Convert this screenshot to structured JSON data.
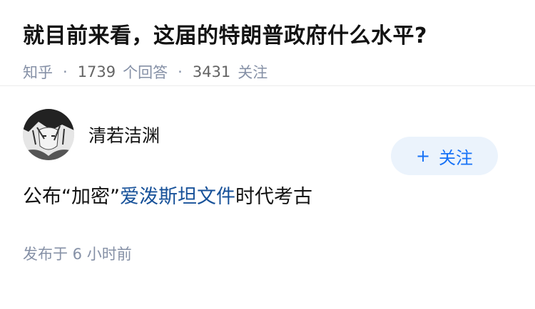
{
  "question": {
    "title": "就目前来看，这届的特朗普政府什么水平?",
    "source": "知乎",
    "answer_count": "1739",
    "answer_label": "个回答",
    "follower_count": "3431",
    "follower_label": "关注"
  },
  "answer": {
    "author_name": "清若洁渊",
    "follow_label": "关注",
    "content_before": "公布“加密”",
    "content_link": "爱泼斯坦文件",
    "content_after": "时代考古",
    "published": "发布于 6 小时前"
  }
}
